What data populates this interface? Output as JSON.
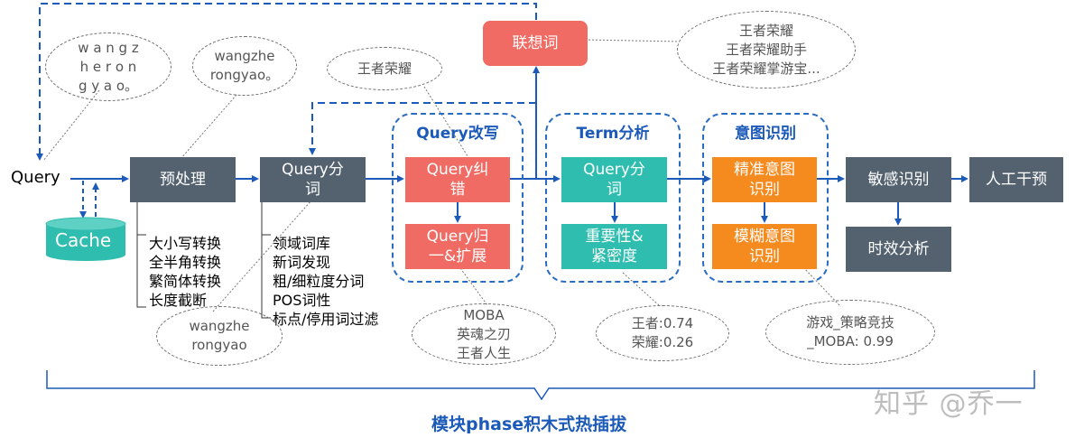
{
  "input_label": "Query",
  "cache_label": "Cache",
  "nodes": {
    "preprocess": "预处理",
    "segment": "Query分\n词",
    "correct": "Query纠\n错",
    "normalize": "Query归\n一&扩展",
    "term_segment": "Query分\n词",
    "importance": "重要性&\n紧密度",
    "precise_intent": "精准意图\n识别",
    "fuzzy_intent": "模糊意图\n识别",
    "sensitive": "敏感识别",
    "manual": "人工干预",
    "timeliness": "时效分析",
    "association": "联想词"
  },
  "groups": {
    "rewrite": "Query改写",
    "term": "Term分析",
    "intent": "意图识别"
  },
  "notes": {
    "preprocess_list": "大小写转换\n全半角转换\n繁简体转换\n长度截断",
    "segment_list": "领域词库\n新词发现\n粗/细粒度分词\nPOS词性\n标点/停用词过滤"
  },
  "bubbles": {
    "raw_spaced": "w a n g z\nh e r o n\ng y a o。",
    "wangzhe_dot": "wangzhe\nrongyao。",
    "wangzhe": "wangzhe\nrongyao",
    "wangzhe_cn": "王者荣耀",
    "association_examples": "王者荣耀\n王者荣耀助手\n王者荣耀掌游宝...",
    "moba_examples": "MOBA\n英魂之刃\n王者人生",
    "term_weights": "王者:0.74\n荣耀:0.26",
    "intent_result": "游戏_策略竞技\n_MOBA: 0.99"
  },
  "footer": "模块phase积木式热插拔",
  "watermark": "知乎 @乔一",
  "colors": {
    "arrow": "#1c5ab9",
    "dark": "#546270",
    "red": "#ef6b63",
    "teal": "#2ebdaf",
    "orange": "#f58a1f",
    "cache": "#2ebdaf"
  }
}
